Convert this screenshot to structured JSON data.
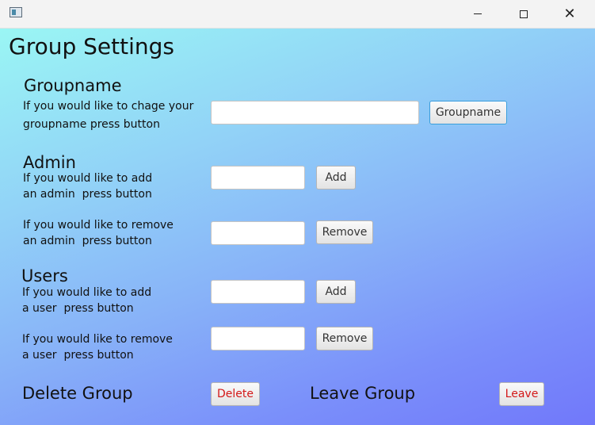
{
  "window": {
    "minimize_glyph": "",
    "close_glyph": "✕"
  },
  "page": {
    "title": "Group Settings"
  },
  "groupname": {
    "title": "Groupname",
    "description": "If you would like to chage your\ngroupname press button",
    "button": "Groupname",
    "input_value": ""
  },
  "admin": {
    "title": "Admin",
    "add_description": "If you would like to add\nan admin  press button",
    "add_button": "Add",
    "remove_description": "If you would like to remove\nan admin  press button",
    "remove_button": "Remove"
  },
  "users": {
    "title": "Users",
    "add_description": "If you would like to add\na user  press button",
    "add_button": "Add",
    "remove_description": "If you would like to remove\na user  press button",
    "remove_button": "Remove"
  },
  "footer": {
    "delete_label": "Delete Group",
    "delete_button": "Delete",
    "leave_label": "Leave Group",
    "leave_button": "Leave"
  },
  "colors": {
    "gradient_start": "#9af6f4",
    "gradient_end": "#7178fa",
    "danger_text": "#d31818",
    "focus_border": "#3a9be0"
  }
}
